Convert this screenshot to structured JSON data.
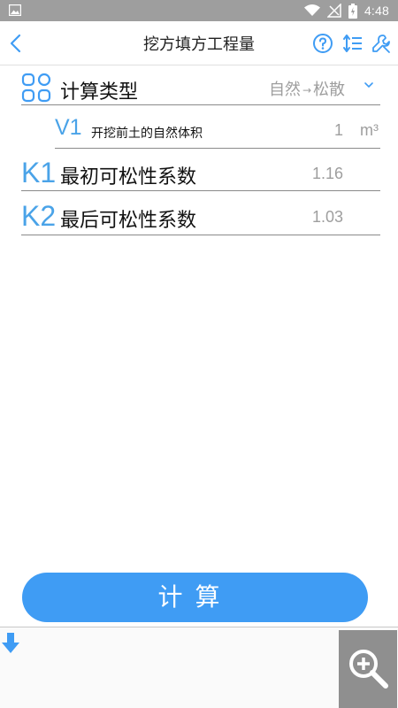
{
  "status_bar": {
    "time": "4:48"
  },
  "app_bar": {
    "title": "挖方填方工程量"
  },
  "calc_type": {
    "label": "计算类型",
    "value_from": "自然",
    "value_arrow": "→",
    "value_to": "松散"
  },
  "v1": {
    "symbol": "V1",
    "label": "开挖前土的自然体积",
    "value": "1",
    "unit": "m³"
  },
  "k1": {
    "symbol": "K1",
    "label": "最初可松性系数",
    "value": "1.16"
  },
  "k2": {
    "symbol": "K2",
    "label": "最后可松性系数",
    "value": "1.03"
  },
  "calculate_button": {
    "label": "计算"
  },
  "colors": {
    "accent": "#3f9cf4",
    "symbol": "#4aa3e8",
    "status_bar": "#9e9e9e",
    "zoom_button": "#8f8f8f"
  },
  "icons": [
    "image-icon",
    "wifi-icon",
    "signal-icon",
    "battery-icon",
    "back-icon",
    "help-icon",
    "sort-icon",
    "tools-icon",
    "grid-icon",
    "chevron-down-icon",
    "download-icon",
    "zoom-in-icon"
  ]
}
